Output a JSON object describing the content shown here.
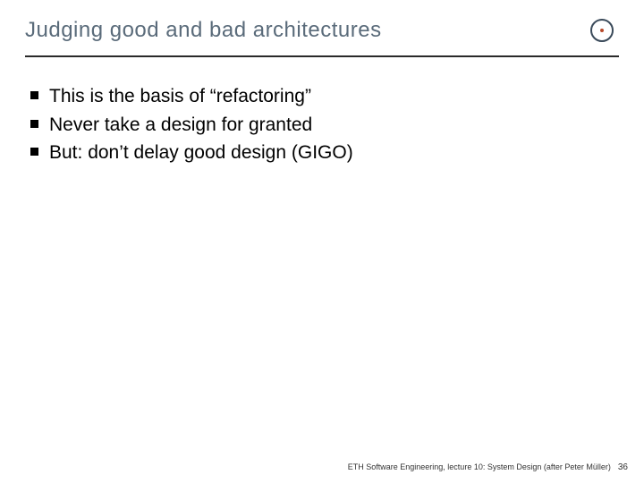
{
  "header": {
    "title": "Judging good and bad architectures",
    "logo": "eth-circle-logo"
  },
  "bullets": [
    "This is the basis of “refactoring”",
    "Never take a design for granted",
    "But: don’t delay good design (GIGO)"
  ],
  "footer": {
    "text": "ETH Software Engineering, lecture 10: System Design (after Peter Müller)",
    "page": "36"
  }
}
